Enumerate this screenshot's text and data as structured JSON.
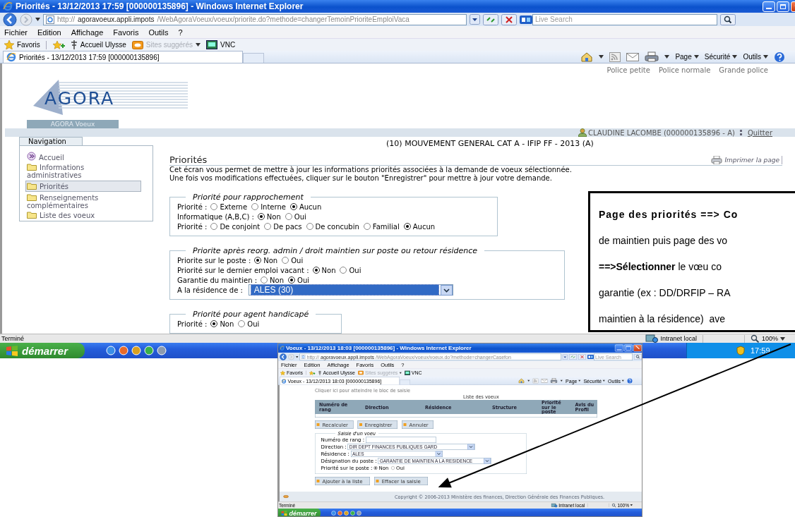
{
  "browser": {
    "title": "Priorités - 13/12/2013 17:59 [000000135896] - Windows Internet Explorer",
    "address": {
      "scheme": "http://",
      "host": "agoravoeux.appli.impots",
      "path": "/WebAgoraVoeux/voeux/priorite.do?methode=changerTemoinPrioriteEmploiVaca"
    },
    "search_placeholder": "Live Search",
    "menu": [
      "Fichier",
      "Edition",
      "Affichage",
      "Favoris",
      "Outils",
      "?"
    ],
    "favorites_label": "Favoris",
    "links": [
      {
        "label": "Accueil Ulysse",
        "kind": "page",
        "disabled": false
      },
      {
        "label": "Sites suggérés",
        "kind": "feed",
        "disabled": true
      },
      {
        "label": "VNC",
        "kind": "app",
        "disabled": false
      }
    ],
    "tab": "Priorités - 13/12/2013 17:59 [000000135896]",
    "commands": [
      "Page",
      "Sécurité",
      "Outils"
    ]
  },
  "page": {
    "font_links": [
      "Police petite",
      "Police normale",
      "Grande police"
    ],
    "logo": "AGORA",
    "app_tab": "AGORA Voeux",
    "user": "CLAUDINE LACOMBE (000000135896 - A)",
    "logout": "Quitter",
    "navigation": {
      "title": "Navigation",
      "items": [
        {
          "label": "Accueil",
          "kind": "home",
          "selected": false
        },
        {
          "label": "Informations administratives",
          "kind": "folder",
          "selected": false
        },
        {
          "label": "Priorités",
          "kind": "folder",
          "selected": true
        },
        {
          "label": "Renseignements complémentaires",
          "kind": "folder",
          "selected": false
        },
        {
          "label": "Liste des voeux",
          "kind": "folder",
          "selected": false
        }
      ]
    },
    "campaign": "(10) MOUVEMENT GENERAL CAT A - IFIP FF - 2013 (A)",
    "heading": "Priorités",
    "print": "Imprimer la page",
    "intro": [
      "Cet écran vous permet de mettre à jour les informations priorités associées à la demande de voeux sélectionnée.",
      "Une fois vos modifications effectuées, cliquer sur le bouton \"Enregistrer\" pour mettre à jour votre demande."
    ],
    "sections": [
      {
        "legend": "Priorité pour rapprochement",
        "rows": [
          {
            "kind": "radio",
            "label": "Priorité :",
            "options": [
              {
                "label": "Externe",
                "selected": false
              },
              {
                "label": "Interne",
                "selected": false
              },
              {
                "label": "Aucun",
                "selected": true
              }
            ]
          },
          {
            "kind": "radio",
            "label": "Informatique (A,B,C) :",
            "options": [
              {
                "label": "Non",
                "selected": true
              },
              {
                "label": "Oui",
                "selected": false
              }
            ]
          },
          {
            "kind": "radio",
            "label": "Priorité :",
            "options": [
              {
                "label": "De conjoint",
                "selected": false
              },
              {
                "label": "De pacs",
                "selected": false
              },
              {
                "label": "De concubin",
                "selected": false
              },
              {
                "label": "Familial",
                "selected": false
              },
              {
                "label": "Aucun",
                "selected": true
              }
            ]
          }
        ]
      },
      {
        "legend": "Priorite après reorg. admin / droit maintien sur poste ou retour résidence",
        "rows": [
          {
            "kind": "radio",
            "label": "Priorite sur le poste :",
            "options": [
              {
                "label": "Non",
                "selected": true
              },
              {
                "label": "Oui",
                "selected": false
              }
            ]
          },
          {
            "kind": "radio",
            "label": "Priorité sur le dernier emploi vacant :",
            "options": [
              {
                "label": "Non",
                "selected": true
              },
              {
                "label": "Oui",
                "selected": false
              }
            ]
          },
          {
            "kind": "radio",
            "label": "Garantie du maintien :",
            "options": [
              {
                "label": "Non",
                "selected": false
              },
              {
                "label": "Oui",
                "selected": true
              }
            ]
          },
          {
            "kind": "select",
            "label": "A la résidence de :",
            "value": "ALES (30)",
            "focused": true
          }
        ]
      },
      {
        "legend": "Priorité pour agent handicapé",
        "rows": [
          {
            "kind": "radio",
            "label": "Priorité :",
            "options": [
              {
                "label": "Non",
                "selected": true
              },
              {
                "label": "Oui",
                "selected": false
              }
            ]
          }
        ]
      }
    ]
  },
  "status_bar": {
    "text": "Terminé",
    "zone": "Intranet local",
    "zoom": "100%"
  },
  "taskbar": {
    "start": "démarrer",
    "clock": "17:59"
  },
  "inset": {
    "browser": {
      "title": "Voeux - 13/12/2013 18:03 [000000135896] - Windows Internet Explorer",
      "address": {
        "scheme": "http://",
        "host": "agoravoeux.appli.impots",
        "path": "/WebAgoraVoeux/voeux/voeux.do?methode=changerCasefon"
      },
      "search_placeholder": "Live Search",
      "menu": [
        "Fichier",
        "Edition",
        "Affichage",
        "Favoris",
        "Outils",
        "?"
      ],
      "favorites_label": "Favoris",
      "links": [
        {
          "label": "Accueil Ulysse",
          "kind": "page",
          "disabled": false
        },
        {
          "label": "Sites suggérés",
          "kind": "feed",
          "disabled": true
        },
        {
          "label": "VNC",
          "kind": "app",
          "disabled": false
        }
      ],
      "tab": "Voeux - 13/12/2013 18:03 [000000135896]",
      "commands": [
        "Page",
        "Sécurité",
        "Outils"
      ]
    },
    "anchor_link": "Cliquer ici pour atteindre le bloc de saisie",
    "table": {
      "caption": "Liste des voeux",
      "columns": [
        "Numéro de rang",
        "Direction",
        "Résidence",
        "Structure",
        "Priorité sur le poste",
        "Avis du Profil"
      ]
    },
    "actions": [
      "Recalculer",
      "Enregistrer",
      "Annuler"
    ],
    "entry": {
      "legend": "Saisie d'un voeu",
      "fields": [
        {
          "kind": "text",
          "label": "Numéro de rang :"
        },
        {
          "kind": "select",
          "label": "Direction :",
          "value": "DIR DEPT FINANCES PUBLIQUES GARD"
        },
        {
          "kind": "select",
          "label": "Résidence :",
          "value": "ALES"
        },
        {
          "kind": "select",
          "label": "Désignation du poste :",
          "value": "GARANTIE DE MAINTIEN A LA RESIDENCE"
        },
        {
          "kind": "radio",
          "label": "Priorité sur le poste :",
          "options": [
            {
              "label": "Non",
              "selected": true
            },
            {
              "label": "Oui",
              "selected": false
            }
          ]
        }
      ]
    },
    "entry_actions": [
      "Ajouter à la liste",
      "Effacer la saisie"
    ],
    "footer": "Copyright © 2006-2013 Ministère des finances, Direction Générale des Finances Publiques.",
    "status_bar": {
      "text": "Terminé",
      "zone": "Intranet local",
      "zoom": "100%"
    },
    "taskbar": {
      "start": "démarrer"
    }
  },
  "callout": {
    "lines": [
      "**Page des priorités ==> Co**",
      "de maintien puis page des vo",
      "**==>Sélectionner** le vœu co",
      "garantie (ex : DD/DRFIP – RA",
      "maintien à la résidence)  ave"
    ]
  }
}
